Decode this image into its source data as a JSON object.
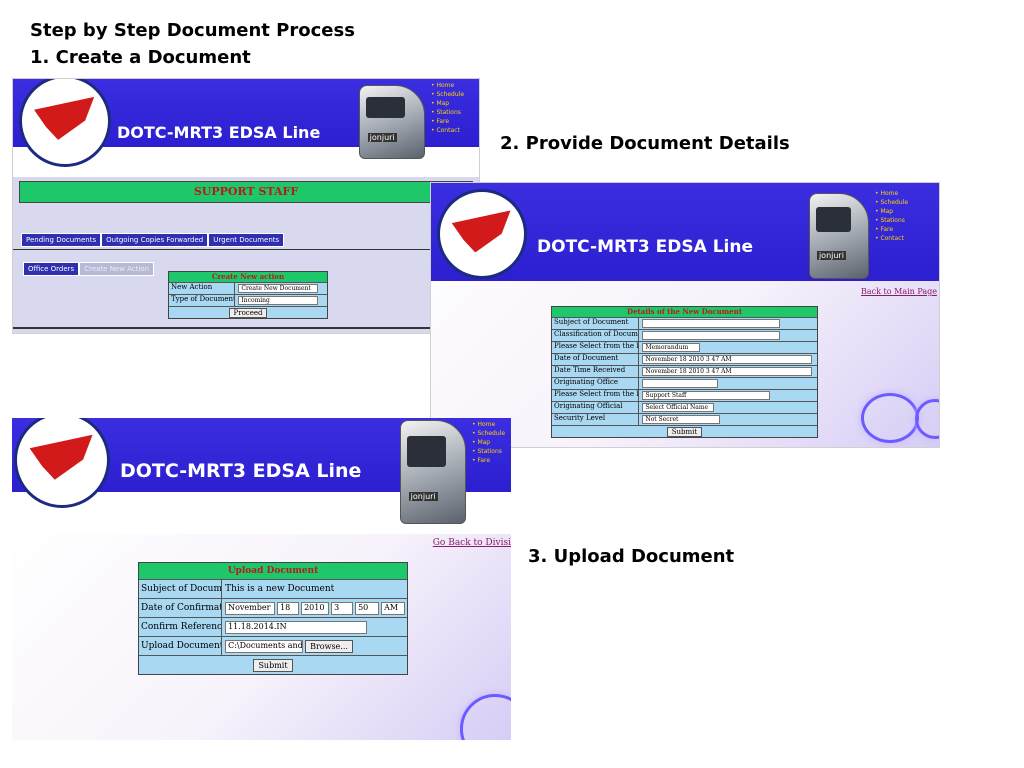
{
  "headings": {
    "main": "Step by Step Document Process",
    "step1": "1. Create a Document",
    "step2": "2. Provide Document Details",
    "step3": "3. Upload Document"
  },
  "banner": {
    "title": "DOTC-MRT3 EDSA Line",
    "train_label": "jonjuri"
  },
  "panel1": {
    "section_bar": "SUPPORT STAFF",
    "tabs": [
      "Pending Documents",
      "Outgoing Copies Forwarded",
      "Urgent Documents"
    ],
    "subtabs": [
      "Office Orders",
      "Create New Action"
    ],
    "form_title": "Create New action",
    "rows": [
      {
        "label": "New Action",
        "value": "Create New Document"
      },
      {
        "label": "Type of Document Received",
        "value": "Incoming"
      }
    ],
    "button": "Proceed"
  },
  "panel2": {
    "back_link": "Back to Main Page",
    "form_title": "Details of the New Document",
    "rows": [
      {
        "label": "Subject of Document",
        "value": ""
      },
      {
        "label": "Classification of Document",
        "value": ""
      },
      {
        "label": "Please Select from the list",
        "value": "Memorandum"
      },
      {
        "label": "Date of Document",
        "value": "November 18 2010 3 47 AM"
      },
      {
        "label": "Date Time Received",
        "value": "November 18 2010 3 47 AM"
      },
      {
        "label": "Originating Office",
        "value": ""
      },
      {
        "label": "Please Select from the list",
        "value": "Support Staff"
      },
      {
        "label": "Originating Official",
        "value": "Select Official Name"
      },
      {
        "label": "Security Level",
        "value": "Not Secret"
      }
    ],
    "button": "Submit"
  },
  "panel3": {
    "back_link": "Go Back to Divisi",
    "form_title": "Upload Document",
    "rows": [
      {
        "label": "Subject of Document",
        "value": "This is a new Document"
      },
      {
        "label": "Date of Confirmation",
        "value": ""
      },
      {
        "label": "Confirm Reference No.",
        "value": "11.18.2014.IN"
      },
      {
        "label": "Upload Document Here",
        "value": "C:\\Documents and Setti"
      }
    ],
    "date_parts": [
      "November",
      "18",
      "2010",
      "3",
      "50",
      "AM"
    ],
    "browse": "Browse...",
    "button": "Submit"
  },
  "colors": {
    "banner": "#3a2ee0",
    "green_bar": "#1ec86a",
    "form_bg": "#a9d8f2"
  }
}
